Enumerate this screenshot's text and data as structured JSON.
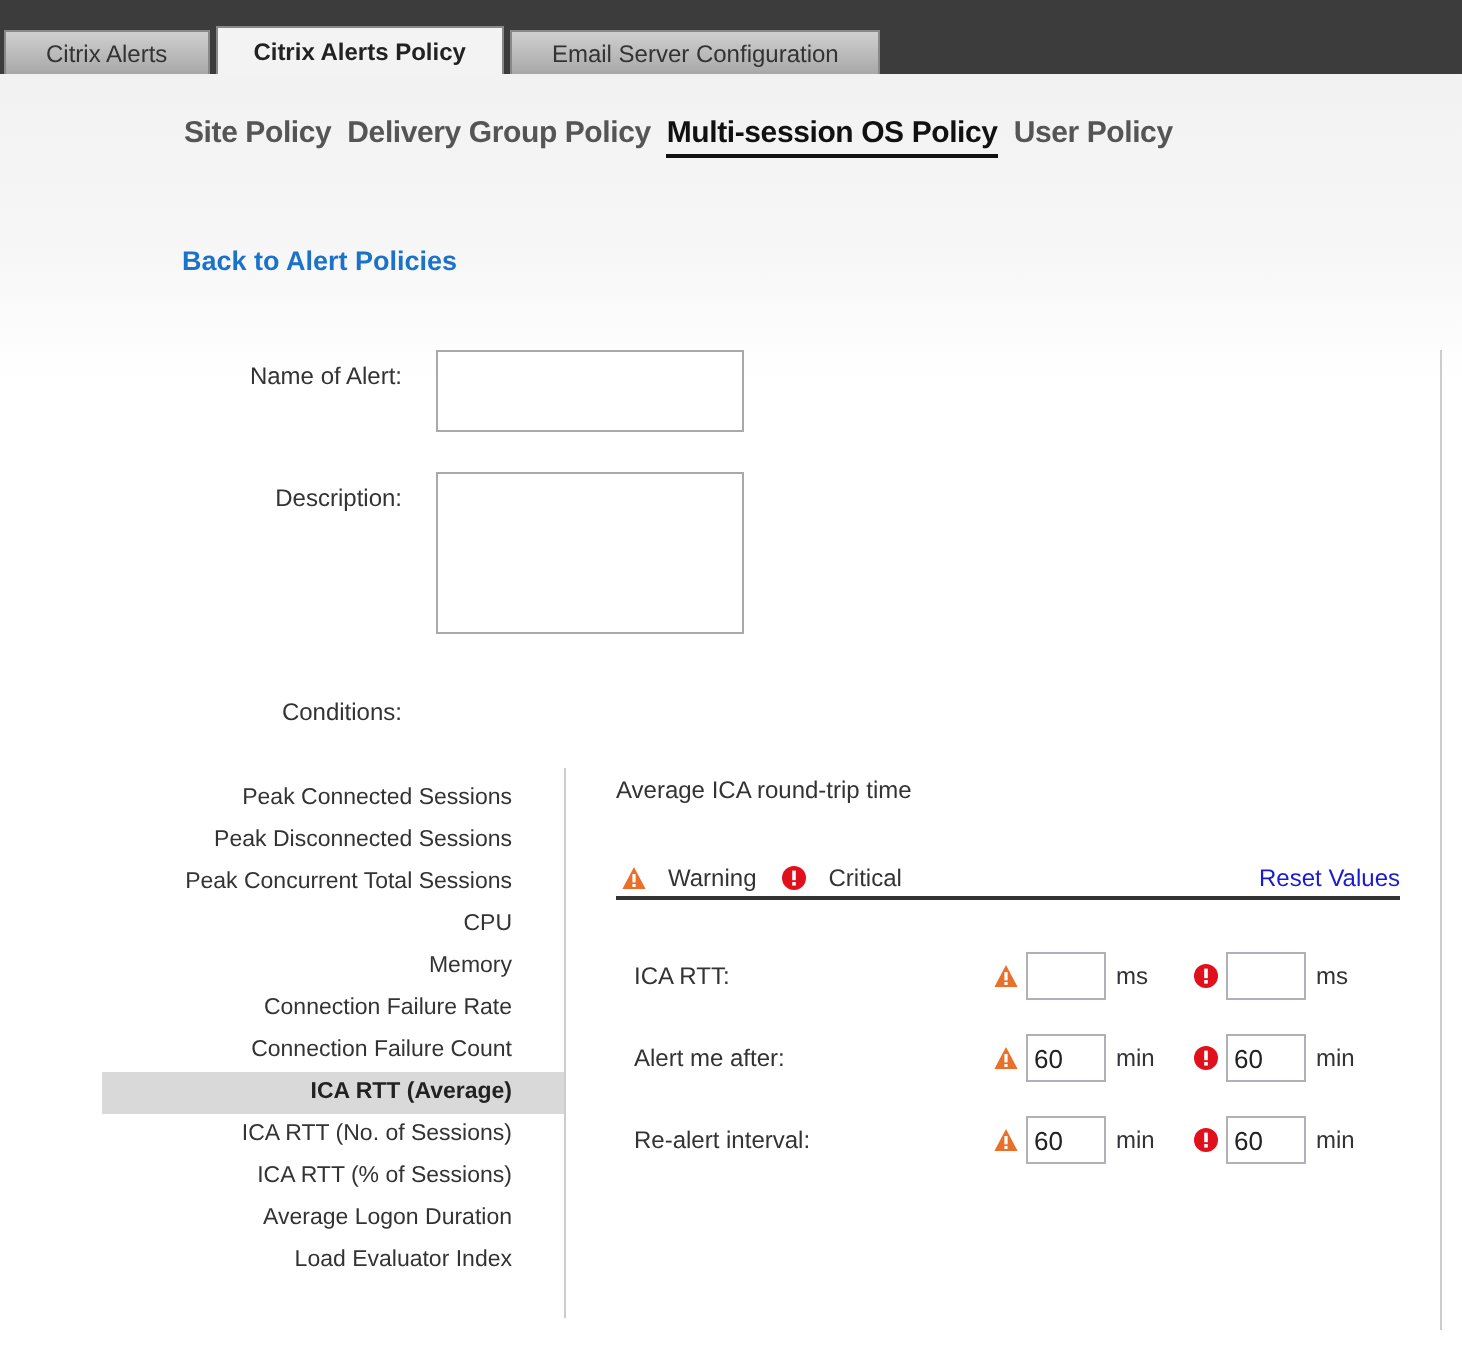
{
  "tabs": [
    {
      "label": "Citrix Alerts",
      "selected": false
    },
    {
      "label": "Citrix Alerts Policy",
      "selected": true
    },
    {
      "label": "Email Server Configuration",
      "selected": false
    }
  ],
  "policy_tabs": [
    {
      "label": "Site Policy",
      "selected": false
    },
    {
      "label": "Delivery Group Policy",
      "selected": false
    },
    {
      "label": "Multi-session OS Policy",
      "selected": true
    },
    {
      "label": "User Policy",
      "selected": false
    }
  ],
  "back_link": "Back to Alert Policies",
  "form": {
    "name_label": "Name of Alert:",
    "description_label": "Description:",
    "conditions_label": "Conditions:"
  },
  "conditions": [
    {
      "label": "Peak Connected Sessions",
      "selected": false
    },
    {
      "label": "Peak Disconnected Sessions",
      "selected": false
    },
    {
      "label": "Peak Concurrent Total Sessions",
      "selected": false
    },
    {
      "label": "CPU",
      "selected": false
    },
    {
      "label": "Memory",
      "selected": false
    },
    {
      "label": "Connection Failure Rate",
      "selected": false
    },
    {
      "label": "Connection Failure Count",
      "selected": false
    },
    {
      "label": "ICA RTT (Average)",
      "selected": true
    },
    {
      "label": "ICA RTT (No. of Sessions)",
      "selected": false
    },
    {
      "label": "ICA RTT (% of Sessions)",
      "selected": false
    },
    {
      "label": "Average Logon Duration",
      "selected": false
    },
    {
      "label": "Load Evaluator Index",
      "selected": false
    }
  ],
  "detail": {
    "title": "Average ICA round-trip time",
    "legend": [
      {
        "kind": "warning",
        "label": "Warning"
      },
      {
        "kind": "critical",
        "label": "Critical"
      }
    ],
    "reset_link": "Reset Values",
    "rows": [
      {
        "label": "ICA RTT:",
        "warning": {
          "unit": "ms"
        },
        "critical": {
          "unit": "ms"
        }
      },
      {
        "label": "Alert me after:",
        "warning": {
          "value": "60",
          "unit": "min"
        },
        "critical": {
          "value": "60",
          "unit": "min"
        }
      },
      {
        "label": "Re-alert interval:",
        "warning": {
          "value": "60",
          "unit": "min"
        },
        "critical": {
          "value": "60",
          "unit": "min"
        }
      }
    ]
  }
}
